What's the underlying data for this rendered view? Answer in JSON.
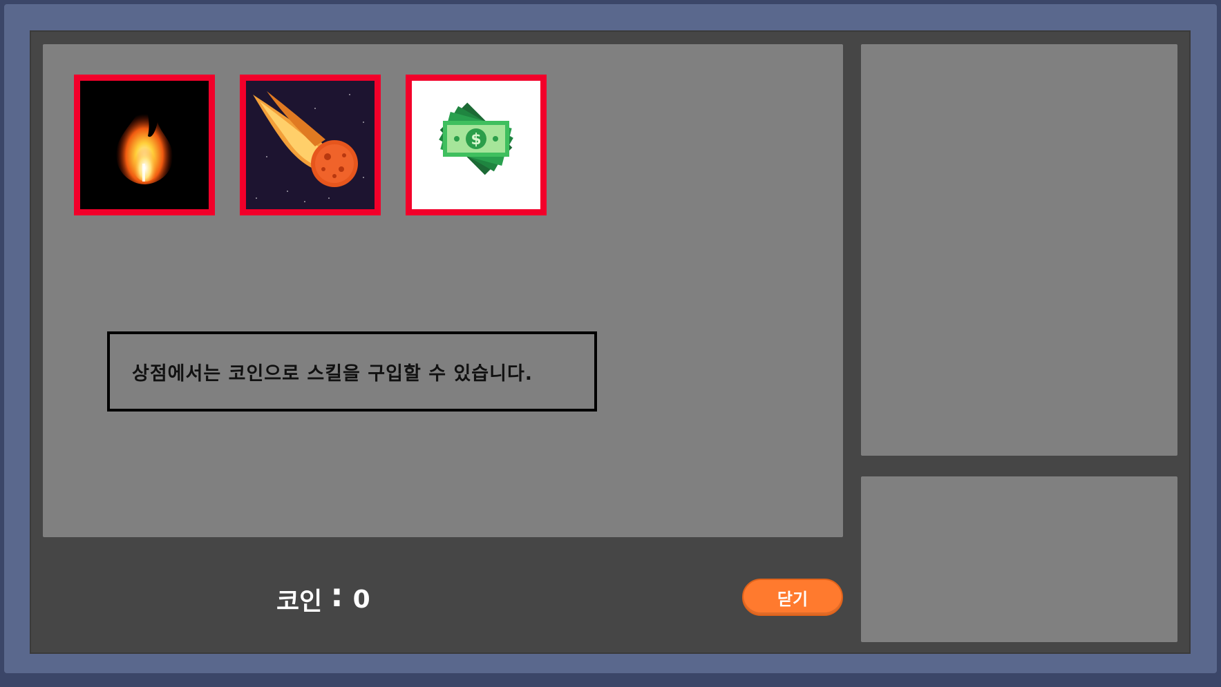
{
  "shop": {
    "skills": [
      {
        "name": "fire",
        "icon": "fire-icon"
      },
      {
        "name": "meteor",
        "icon": "meteor-icon"
      },
      {
        "name": "money",
        "icon": "money-icon"
      }
    ],
    "info_text": "상점에서는 코인으로 스킬을 구입할 수 있습니다.",
    "slot_border_color": "#f2002a"
  },
  "footer": {
    "coin_label": "코인",
    "coin_separator": ":",
    "coin_value": "0",
    "close_label": "닫기",
    "close_color": "#ff7a2e"
  },
  "colors": {
    "frame": "#5a688d",
    "panel": "#464646",
    "area": "#808080"
  }
}
